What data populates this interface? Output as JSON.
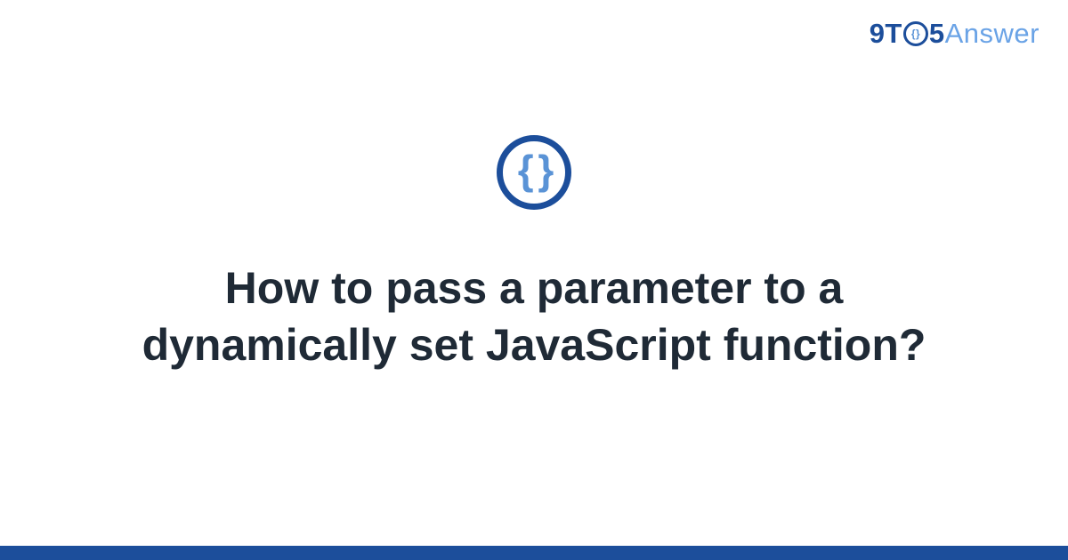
{
  "brand": {
    "prefix": "9T",
    "middle_icon": "braces-mini-icon",
    "suffix_digit": "5",
    "answer": "Answer"
  },
  "topic": {
    "icon_glyph": "{ }",
    "icon_name": "braces-icon"
  },
  "title": "How to pass a parameter to a dynamically set JavaScript function?",
  "colors": {
    "brand_primary": "#1c4e9b",
    "brand_light": "#6aa3e6",
    "icon_inner": "#5a93d6",
    "text": "#1f2a36",
    "background": "#ffffff"
  }
}
